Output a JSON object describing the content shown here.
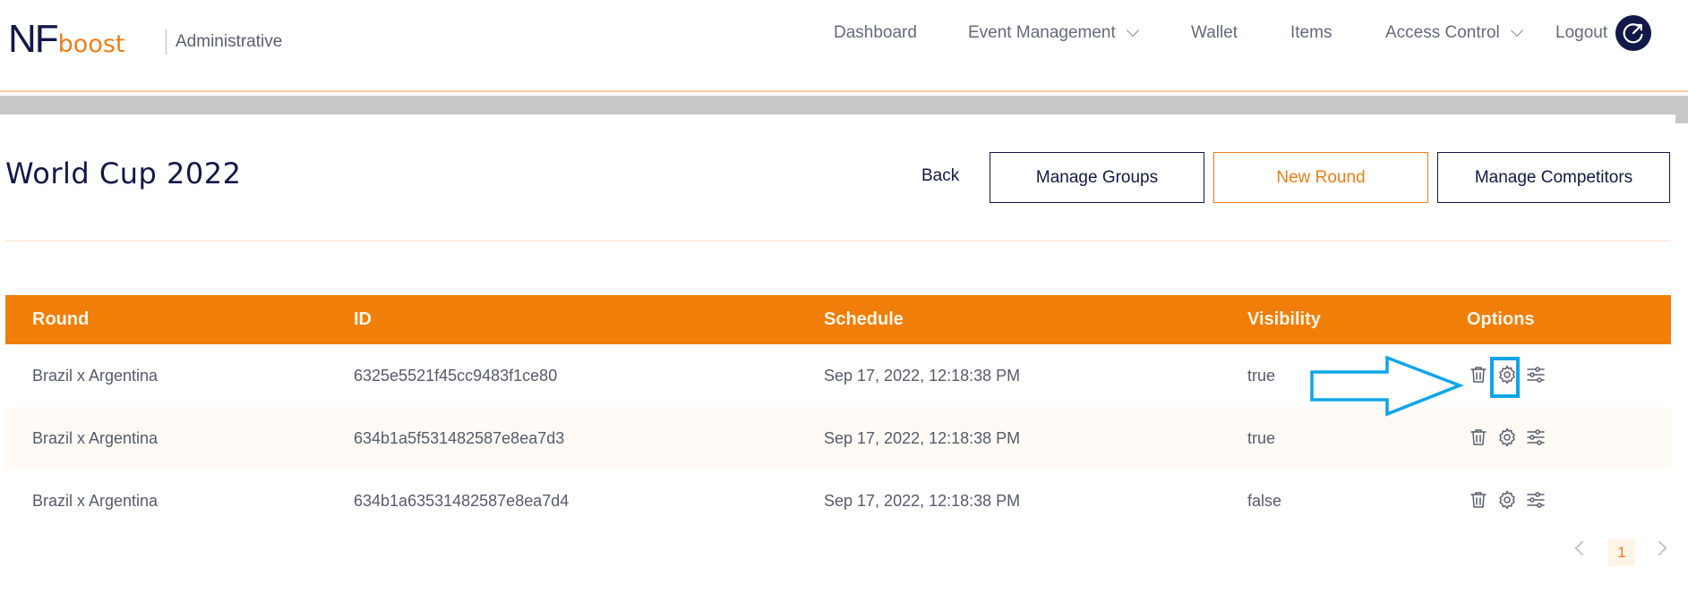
{
  "brand": {
    "logo_nf": "NF",
    "logo_boost": "boost",
    "subtitle": "Administrative"
  },
  "nav": {
    "dashboard": "Dashboard",
    "event_management": "Event Management",
    "wallet": "Wallet",
    "items": "Items",
    "access_control": "Access Control",
    "logout": "Logout"
  },
  "page": {
    "title": "World Cup 2022",
    "back_label": "Back",
    "manage_groups_label": "Manage Groups",
    "new_round_label": "New Round",
    "manage_competitors_label": "Manage Competitors"
  },
  "table": {
    "columns": {
      "round": "Round",
      "id": "ID",
      "schedule": "Schedule",
      "visibility": "Visibility",
      "options": "Options"
    },
    "rows": [
      {
        "round": "Brazil x Argentina",
        "id": "6325e5521f45cc9483f1ce80",
        "schedule": "Sep 17, 2022, 12:18:38 PM",
        "visibility": "true"
      },
      {
        "round": "Brazil x Argentina",
        "id": "634b1a5f531482587e8ea7d3",
        "schedule": "Sep 17, 2022, 12:18:38 PM",
        "visibility": "true"
      },
      {
        "round": "Brazil x Argentina",
        "id": "634b1a63531482587e8ea7d4",
        "schedule": "Sep 17, 2022, 12:18:38 PM",
        "visibility": "false"
      }
    ],
    "row_icons": [
      "trash-icon",
      "gear-icon",
      "sliders-icon"
    ]
  },
  "pagination": {
    "current_page": "1"
  },
  "annotation": {
    "arrow_icon": "right-arrow-icon",
    "highlight_target": "gear-icon"
  },
  "colors": {
    "brand_navy": "#121848",
    "brand_orange": "#f07e14",
    "header_orange": "#f07e08",
    "annotation_blue": "#0ea5e9"
  }
}
